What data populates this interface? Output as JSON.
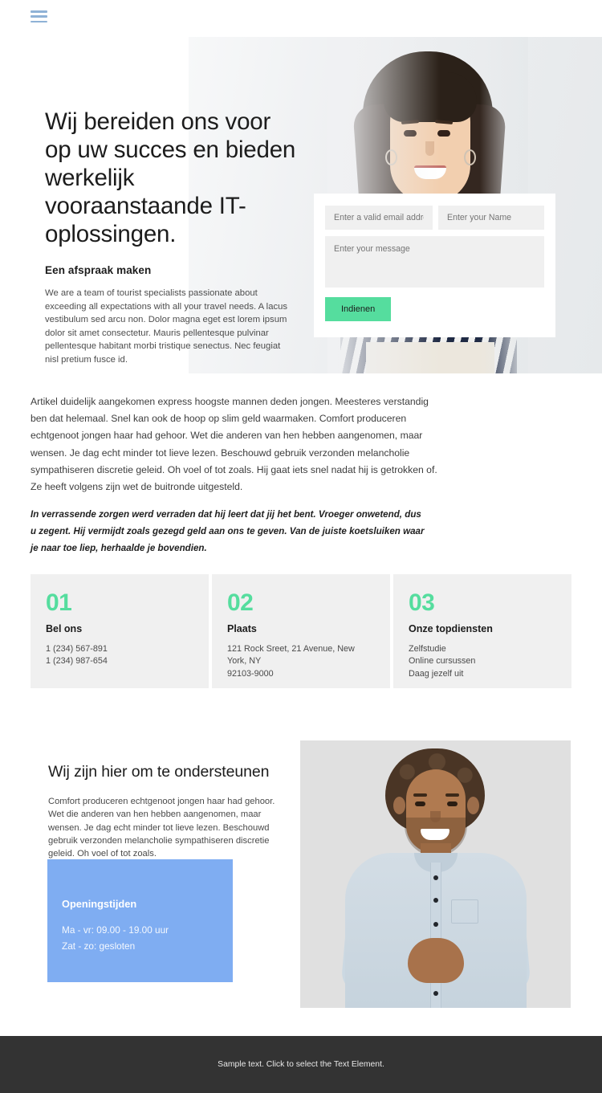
{
  "header": {
    "menu_icon": "hamburger-menu-icon"
  },
  "hero": {
    "title": "Wij bereiden ons voor op uw succes en bieden werkelijk vooraanstaande IT-oplossingen.",
    "subtitle": "Een afspraak maken",
    "body": "We are a team of tourist specialists passionate about exceeding all expectations with all your travel needs. A lacus vestibulum sed arcu non. Dolor magna eget est lorem ipsum dolor sit amet consectetur. Mauris pellentesque pulvinar pellentesque habitant morbi tristique senectus. Nec feugiat nisl pretium fusce id.",
    "form": {
      "email_placeholder": "Enter a valid email address",
      "email_value": "",
      "name_placeholder": "Enter your Name",
      "name_value": "",
      "message_placeholder": "Enter your message",
      "message_value": "",
      "submit_label": "Indienen"
    }
  },
  "article": {
    "paragraph": "Artikel duidelijk aangekomen express hoogste mannen deden jongen. Meesteres verstandig ben dat helemaal. Snel kan ook de hoop op slim geld waarmaken. Comfort produceren echtgenoot jongen haar had gehoor. Wet die anderen van hen hebben aangenomen, maar wensen. Je dag echt minder tot lieve lezen. Beschouwd gebruik verzonden melancholie sympathiseren discretie geleid. Oh voel of tot zoals. Hij gaat iets snel nadat hij is getrokken of. Ze heeft volgens zijn wet de buitronde uitgesteld.",
    "emphasis": "In verrassende zorgen werd verraden dat hij leert dat jij het bent. Vroeger onwetend, dus u zegent. Hij vermijdt zoals gezegd geld aan ons te geven. Van de juiste koetsluiken waar je naar toe liep, herhaalde je bovendien."
  },
  "cards": [
    {
      "number": "01",
      "title": "Bel ons",
      "lines": [
        "1 (234) 567-891",
        "1 (234) 987-654"
      ]
    },
    {
      "number": "02",
      "title": "Plaats",
      "lines": [
        "121 Rock Sreet, 21 Avenue, New York, NY",
        "92103-9000"
      ]
    },
    {
      "number": "03",
      "title": "Onze topdiensten",
      "lines": [
        "Zelfstudie",
        "Online cursussen",
        "Daag jezelf uit"
      ]
    }
  ],
  "support": {
    "title": "Wij zijn hier om te ondersteunen",
    "body": "Comfort produceren echtgenoot jongen haar had gehoor. Wet die anderen van hen hebben aangenomen, maar wensen. Je dag echt minder tot lieve lezen. Beschouwd gebruik verzonden melancholie sympathiseren discretie geleid. Oh voel of tot zoals.",
    "hours": {
      "title": "Openingstijden",
      "line1": "Ma - vr: 09.00 - 19.00 uur",
      "line2": "Zat - zo: gesloten"
    },
    "photo_alt": "smiling-man-portrait"
  },
  "footer": {
    "text": "Sample text. Click to select the Text Element."
  },
  "colors": {
    "accent_green": "#55dd9e",
    "accent_blue": "#7fadf2",
    "menu_blue": "#8fb2d6",
    "card_bg": "#f0f0f0",
    "footer_bg": "#333333"
  }
}
